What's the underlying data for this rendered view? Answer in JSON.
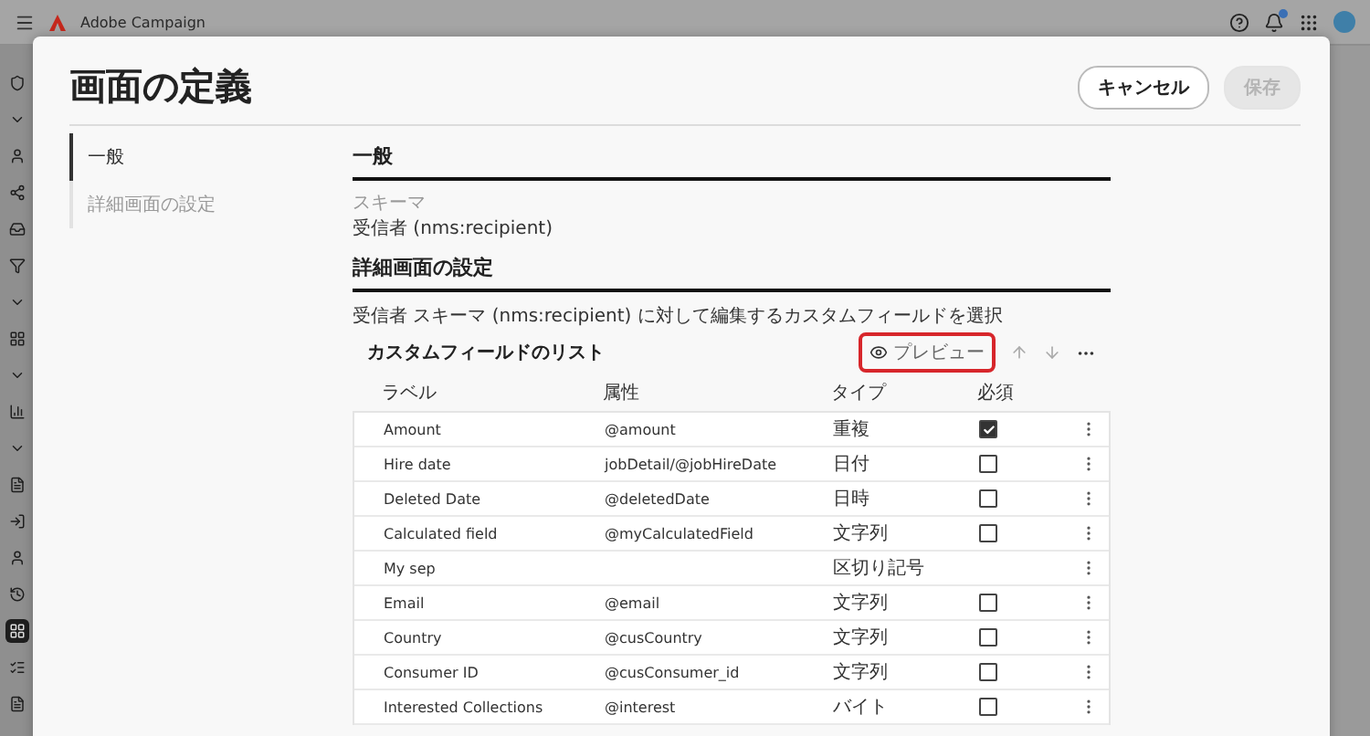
{
  "app_bar": {
    "product": "Adobe Campaign",
    "notifications_badge": true
  },
  "dialog": {
    "title": "画面の定義",
    "buttons": [
      {
        "label": "キャンセル",
        "disabled": false
      },
      {
        "label": "保存",
        "disabled": true
      }
    ],
    "nav": [
      {
        "label": "一般",
        "selected": true
      },
      {
        "label": "詳細画面の設定",
        "selected": false
      }
    ],
    "general": {
      "heading": "一般",
      "schema_label": "スキーマ",
      "schema_value": "受信者 (nms:recipient)"
    },
    "details": {
      "heading": "詳細画面の設定",
      "description": "受信者 スキーマ (nms:recipient) に対して編集するカスタムフィールドを選択",
      "list_title": "カスタムフィールドのリスト",
      "preview_button": "プレビュー",
      "preview_highlighted": true,
      "table": {
        "columns": [
          "ラベル",
          "属性",
          "タイプ",
          "必須"
        ],
        "rows": [
          {
            "kind": "field",
            "label": "Amount",
            "attribute": "@amount",
            "type": "重複",
            "required": true
          },
          {
            "kind": "field",
            "label": "Hire date",
            "attribute": "jobDetail/@jobHireDate",
            "type": "日付",
            "required": false
          },
          {
            "kind": "field",
            "label": "Deleted Date",
            "attribute": "@deletedDate",
            "type": "日時",
            "required": false
          },
          {
            "kind": "field",
            "label": "Calculated field",
            "attribute": "@myCalculatedField",
            "type": "文字列",
            "required": false
          },
          {
            "kind": "separator",
            "label": "My sep",
            "type": "区切り記号"
          },
          {
            "kind": "field",
            "label": "Email",
            "attribute": "@email",
            "type": "文字列",
            "required": false
          },
          {
            "kind": "field",
            "label": "Country",
            "attribute": "@cusCountry",
            "type": "文字列",
            "required": false
          },
          {
            "kind": "field",
            "label": "Consumer ID",
            "attribute": "@cusConsumer_id",
            "type": "文字列",
            "required": false
          },
          {
            "kind": "field",
            "label": "Interested Collections",
            "attribute": "@interest",
            "type": "バイト",
            "required": false
          }
        ]
      }
    }
  }
}
